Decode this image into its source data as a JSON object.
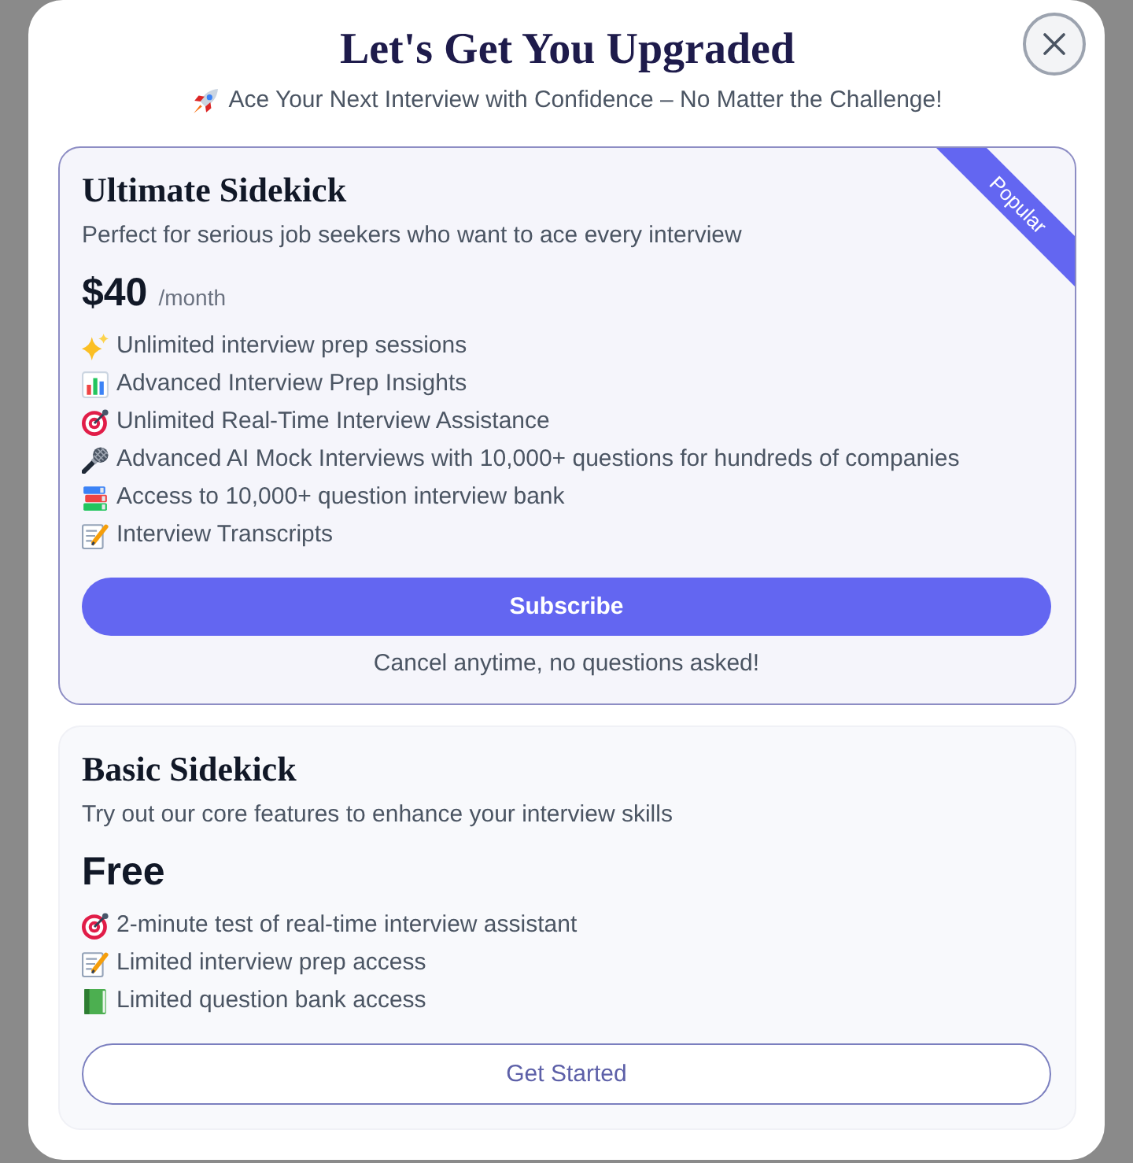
{
  "dialog": {
    "title": "Let's Get You Upgraded",
    "subtitle": "Ace Your Next Interview with Confidence – No Matter the Challenge!"
  },
  "plans": [
    {
      "title": "Ultimate Sidekick",
      "description": "Perfect for serious job seekers who want to ace every interview",
      "price": "$40",
      "period": "/month",
      "featured": true,
      "badge": "Popular",
      "features": [
        {
          "kind": "sparkles",
          "text": "Unlimited interview prep sessions"
        },
        {
          "kind": "chart",
          "text": "Advanced Interview Prep Insights"
        },
        {
          "kind": "target",
          "text": "Unlimited Real-Time Interview Assistance"
        },
        {
          "kind": "microphone",
          "text": "Advanced AI Mock Interviews with 10,000+ questions for hundreds of companies"
        },
        {
          "kind": "books",
          "text": "Access to 10,000+ question interview bank"
        },
        {
          "kind": "memo",
          "text": "Interview Transcripts"
        }
      ],
      "button": {
        "label": "Subscribe",
        "kind": "filled"
      },
      "note": "Cancel anytime, no questions asked!"
    },
    {
      "title": "Basic Sidekick",
      "description": "Try out our core features to enhance your interview skills",
      "price": "Free",
      "featured": false,
      "features": [
        {
          "kind": "target",
          "text": "2-minute test of real-time interview assistant"
        },
        {
          "kind": "memo",
          "text": "Limited interview prep access"
        },
        {
          "kind": "book",
          "text": "Limited question bank access"
        }
      ],
      "button": {
        "label": "Get Started",
        "kind": "outline"
      }
    }
  ]
}
